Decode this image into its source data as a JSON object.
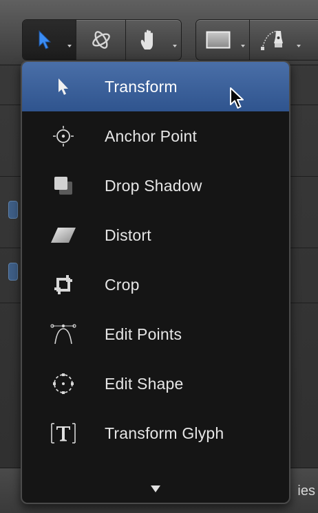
{
  "toolbar": {
    "groups": [
      {
        "name": "selection-tools",
        "tools": [
          "select-arrow",
          "3d-transform",
          "pan-hand"
        ]
      },
      {
        "name": "shape-tools",
        "tools": [
          "rectangle",
          "bezier-pen"
        ]
      }
    ]
  },
  "menu": {
    "items": [
      {
        "label": "Transform",
        "icon": "arrow-cursor-icon",
        "selected": true
      },
      {
        "label": "Anchor Point",
        "icon": "anchor-point-icon"
      },
      {
        "label": "Drop Shadow",
        "icon": "drop-shadow-icon"
      },
      {
        "label": "Distort",
        "icon": "distort-icon"
      },
      {
        "label": "Crop",
        "icon": "crop-icon"
      },
      {
        "label": "Edit Points",
        "icon": "edit-points-icon"
      },
      {
        "label": "Edit Shape",
        "icon": "edit-shape-icon"
      },
      {
        "label": "Transform Glyph",
        "icon": "transform-glyph-icon"
      }
    ],
    "more_indicator": "scroll-down-arrow-icon"
  },
  "background": {
    "bottom_label": "ies"
  },
  "colors": {
    "selection": "#3d62a0",
    "menu_bg": "#151515",
    "active_tool": "#3b8df5"
  }
}
